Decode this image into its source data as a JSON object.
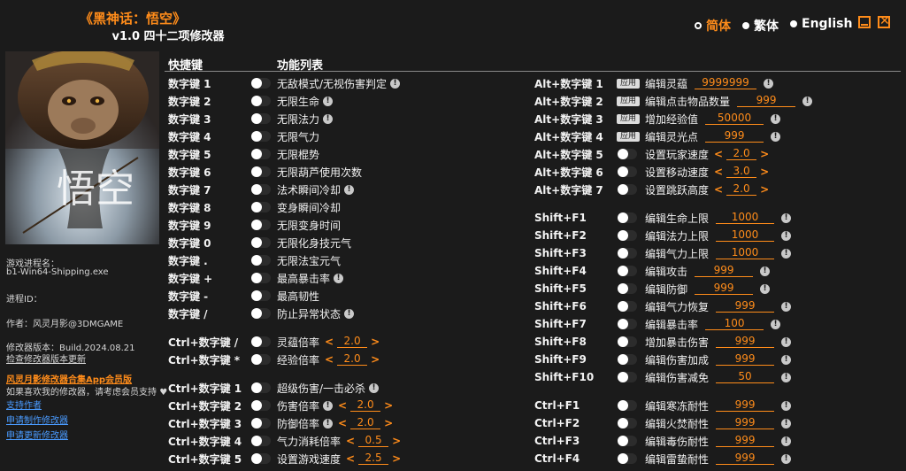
{
  "app": {
    "game_title": "《黑神话：悟空》",
    "subtitle": "v1.0 四十二项修改器"
  },
  "languages": [
    {
      "label": "简体",
      "active": true
    },
    {
      "label": "繁体",
      "active": false
    },
    {
      "label": "English",
      "active": false
    }
  ],
  "sidebar": {
    "process_label": "游戏进程名：",
    "process_value": "b1-Win64-Shipping.exe",
    "pid_label": "进程ID：",
    "author": "作者：风灵月影@3DMGAME",
    "version": "修改器版本：Build.2024.08.21",
    "check_update": "检查修改器版本更新",
    "vip_title": "风灵月影修改器合集App会员版",
    "support_text": "如果喜欢我的修改器，请考虑会员支持",
    "links": [
      "支持作者",
      "申请制作修改器",
      "申请更新修改器"
    ]
  },
  "headers": {
    "hotkey": "快捷键",
    "function_list": "功能列表"
  },
  "left_rows": [
    {
      "key": "数字键 1",
      "label": "无敌模式/无视伤害判定",
      "info": true
    },
    {
      "key": "数字键 2",
      "label": "无限生命",
      "info": true
    },
    {
      "key": "数字键 3",
      "label": "无限法力",
      "info": true
    },
    {
      "key": "数字键 4",
      "label": "无限气力",
      "info": false
    },
    {
      "key": "数字键 5",
      "label": "无限棍势",
      "info": false
    },
    {
      "key": "数字键 6",
      "label": "无限葫芦使用次数",
      "info": false
    },
    {
      "key": "数字键 7",
      "label": "法术瞬间冷却",
      "info": true
    },
    {
      "key": "数字键 8",
      "label": "变身瞬间冷却",
      "info": false
    },
    {
      "key": "数字键 9",
      "label": "无限变身时间",
      "info": false
    },
    {
      "key": "数字键 0",
      "label": "无限化身技元气",
      "info": false
    },
    {
      "key": "数字键 .",
      "label": "无限法宝元气",
      "info": false
    },
    {
      "key": "数字键 +",
      "label": "最高暴击率",
      "info": true
    },
    {
      "key": "数字键 -",
      "label": "最高韧性",
      "info": false
    },
    {
      "key": "数字键 /",
      "label": "防止异常状态",
      "info": true
    },
    {
      "key": "Ctrl+数字键 /",
      "label": "灵蕴倍率",
      "info": false,
      "value": "2.0"
    },
    {
      "key": "Ctrl+数字键 *",
      "label": "经验倍率",
      "info": false,
      "value": "2.0"
    },
    {
      "key": "Ctrl+数字键 1",
      "label": "超级伤害/一击必杀",
      "info": true
    },
    {
      "key": "Ctrl+数字键 2",
      "label": "伤害倍率",
      "info": true,
      "value": "2.0"
    },
    {
      "key": "Ctrl+数字键 3",
      "label": "防御倍率",
      "info": true,
      "value": "2.0"
    },
    {
      "key": "Ctrl+数字键 4",
      "label": "气力消耗倍率",
      "info": false,
      "value": "0.5"
    },
    {
      "key": "Ctrl+数字键 5",
      "label": "设置游戏速度",
      "info": false,
      "value": "2.5"
    }
  ],
  "right_rows": [
    {
      "key": "Alt+数字键 1",
      "apply": "应用",
      "label": "编辑灵蕴",
      "value": "9999999",
      "info": true
    },
    {
      "key": "Alt+数字键 2",
      "apply": "应用",
      "label": "编辑点击物品数量",
      "value": "999",
      "info": true
    },
    {
      "key": "Alt+数字键 3",
      "apply": "应用",
      "label": "增加经验值",
      "value": "50000",
      "info": true
    },
    {
      "key": "Alt+数字键 4",
      "apply": "应用",
      "label": "编辑灵光点",
      "value": "999",
      "info": true
    },
    {
      "key": "Alt+数字键 5",
      "label": "设置玩家速度",
      "value": "2.0",
      "arrows": true,
      "info": false
    },
    {
      "key": "Alt+数字键 6",
      "label": "设置移动速度",
      "value": "3.0",
      "arrows": true,
      "info": false
    },
    {
      "key": "Alt+数字键 7",
      "label": "设置跳跃高度",
      "value": "2.0",
      "arrows": true,
      "info": false
    },
    {
      "key": "Shift+F1",
      "label": "编辑生命上限",
      "value": "1000",
      "info": true
    },
    {
      "key": "Shift+F2",
      "label": "编辑法力上限",
      "value": "1000",
      "info": true
    },
    {
      "key": "Shift+F3",
      "label": "编辑气力上限",
      "value": "1000",
      "info": true
    },
    {
      "key": "Shift+F4",
      "label": "编辑攻击",
      "value": "999",
      "info": true
    },
    {
      "key": "Shift+F5",
      "label": "编辑防御",
      "value": "999",
      "info": true
    },
    {
      "key": "Shift+F6",
      "label": "编辑气力恢复",
      "value": "999",
      "info": true
    },
    {
      "key": "Shift+F7",
      "label": "编辑暴击率",
      "value": "100",
      "info": true
    },
    {
      "key": "Shift+F8",
      "label": "增加暴击伤害",
      "value": "999",
      "info": true
    },
    {
      "key": "Shift+F9",
      "label": "编辑伤害加成",
      "value": "999",
      "info": true
    },
    {
      "key": "Shift+F10",
      "label": "编辑伤害减免",
      "value": "50",
      "info": true
    },
    {
      "key": "Ctrl+F1",
      "label": "编辑寒冻耐性",
      "value": "999",
      "info": true
    },
    {
      "key": "Ctrl+F2",
      "label": "编辑火焚耐性",
      "value": "999",
      "info": true
    },
    {
      "key": "Ctrl+F3",
      "label": "编辑毒伤耐性",
      "value": "999",
      "info": true
    },
    {
      "key": "Ctrl+F4",
      "label": "编辑雷蛰耐性",
      "value": "999",
      "info": true
    }
  ],
  "cover_logo": "悟空",
  "colors": {
    "accent": "#ff8c1a",
    "background": "#1b1b1b",
    "link": "#4a9bff"
  }
}
